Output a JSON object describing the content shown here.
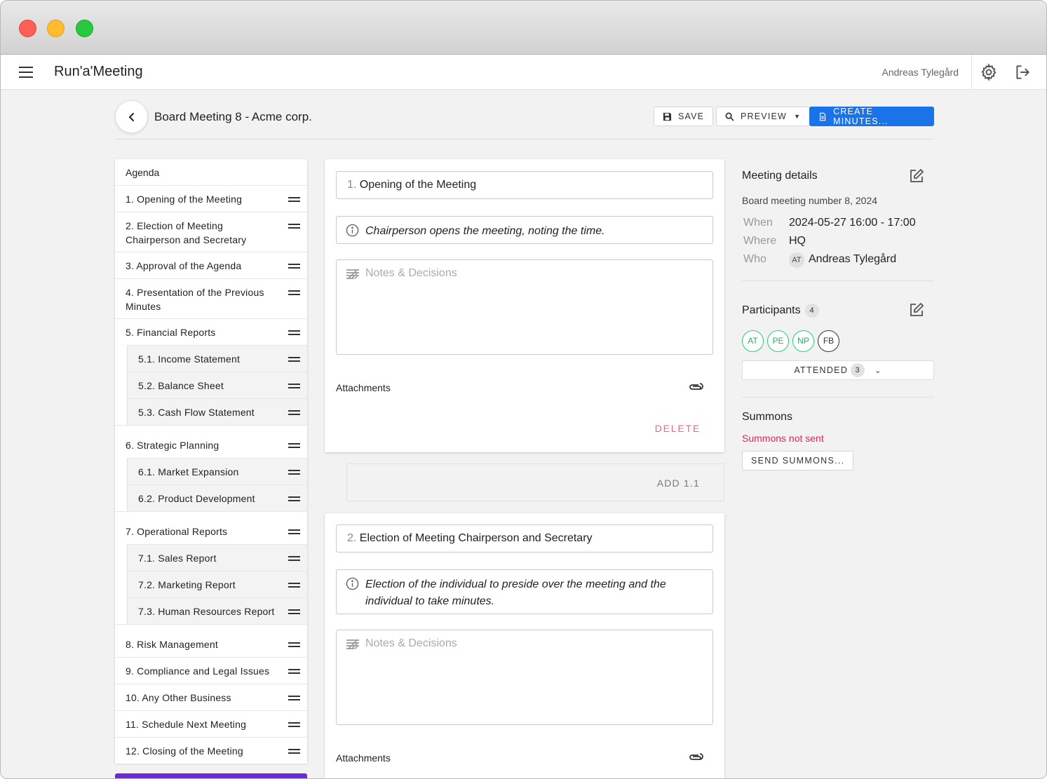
{
  "app": {
    "title": "Run'a'Meeting",
    "user": "Andreas Tylegård"
  },
  "header": {
    "meeting_title": "Board Meeting 8 - Acme corp.",
    "save_label": "SAVE",
    "preview_label": "PREVIEW",
    "create_minutes_label": "CREATE MINUTES..."
  },
  "agenda": {
    "heading": "Agenda",
    "items": [
      {
        "label": "1.  Opening of the Meeting",
        "sub": false
      },
      {
        "label": "2.  Election of Meeting Chairperson and Secretary",
        "sub": false
      },
      {
        "label": "3.  Approval of the Agenda",
        "sub": false
      },
      {
        "label": "4.  Presentation of the Previous Minutes",
        "sub": false
      },
      {
        "label": "5.  Financial Reports",
        "sub": false
      },
      {
        "label": "5.1.  Income Statement",
        "sub": true
      },
      {
        "label": "5.2.  Balance Sheet",
        "sub": true
      },
      {
        "label": "5.3.  Cash Flow Statement",
        "sub": true
      },
      {
        "label": "6.  Strategic Planning",
        "sub": false
      },
      {
        "label": "6.1.  Market Expansion",
        "sub": true
      },
      {
        "label": "6.2.  Product Development",
        "sub": true
      },
      {
        "label": "7.  Operational Reports",
        "sub": false
      },
      {
        "label": "7.1.  Sales Report",
        "sub": true
      },
      {
        "label": "7.2.  Marketing Report",
        "sub": true
      },
      {
        "label": "7.3.  Human Resources Report",
        "sub": true
      },
      {
        "label": "8.  Risk Management",
        "sub": false
      },
      {
        "label": "9.  Compliance and Legal Issues",
        "sub": false
      },
      {
        "label": "10.  Any Other Business",
        "sub": false
      },
      {
        "label": "11.  Schedule Next Meeting",
        "sub": false
      },
      {
        "label": "12.  Closing of the Meeting",
        "sub": false
      }
    ]
  },
  "items": [
    {
      "number": "1.",
      "title": "Opening of the Meeting",
      "description": "Chairperson opens the meeting, noting the time.",
      "notes_placeholder": "Notes & Decisions",
      "attachments_label": "Attachments",
      "delete_label": "DELETE"
    },
    {
      "number": "2.",
      "title": "Election of Meeting Chairperson and Secretary",
      "description": "Election of the individual to preside over the meeting and the individual to take minutes.",
      "notes_placeholder": "Notes & Decisions",
      "attachments_label": "Attachments"
    }
  ],
  "add_subitem_label": "ADD 1.1",
  "details": {
    "heading": "Meeting details",
    "subtitle": "Board meeting number 8, 2024",
    "when_label": "When",
    "when": "2024-05-27 16:00 - 17:00",
    "where_label": "Where",
    "where": "HQ",
    "who_label": "Who",
    "who_initials": "AT",
    "who": "Andreas Tylegård"
  },
  "participants": {
    "heading": "Participants",
    "count": "4",
    "avatars": [
      {
        "initials": "AT",
        "attended": true
      },
      {
        "initials": "PE",
        "attended": true
      },
      {
        "initials": "NP",
        "attended": true
      },
      {
        "initials": "FB",
        "attended": false
      }
    ],
    "attended_label": "ATTENDED",
    "attended_count": "3"
  },
  "summons": {
    "heading": "Summons",
    "status": "Summons not sent",
    "send_label": "SEND SUMMONS..."
  },
  "colors": {
    "primary": "#1a73e8",
    "danger": "#e91e63",
    "delete": "#f06292",
    "attended": "#2ecc71",
    "accent_bar": "#6d28d9"
  }
}
